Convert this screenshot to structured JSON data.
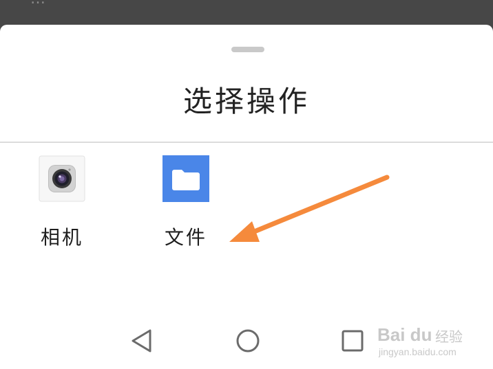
{
  "backdrop": {
    "partial_text": "…"
  },
  "sheet": {
    "title": "选择操作"
  },
  "apps": [
    {
      "label": "相机",
      "icon": "camera-icon"
    },
    {
      "label": "文件",
      "icon": "folder-icon"
    }
  ],
  "annotation": {
    "arrow_color": "#f58a3c"
  },
  "navbar": {
    "back_icon": "triangle-back-icon",
    "home_icon": "circle-home-icon",
    "recent_icon": "square-recent-icon"
  },
  "watermark": {
    "brand": "Bai du",
    "name": "经验",
    "url": "jingyan.baidu.com"
  },
  "colors": {
    "files_icon_bg": "#4a86e8",
    "backdrop": "#474747",
    "arrow": "#f58a3c"
  }
}
